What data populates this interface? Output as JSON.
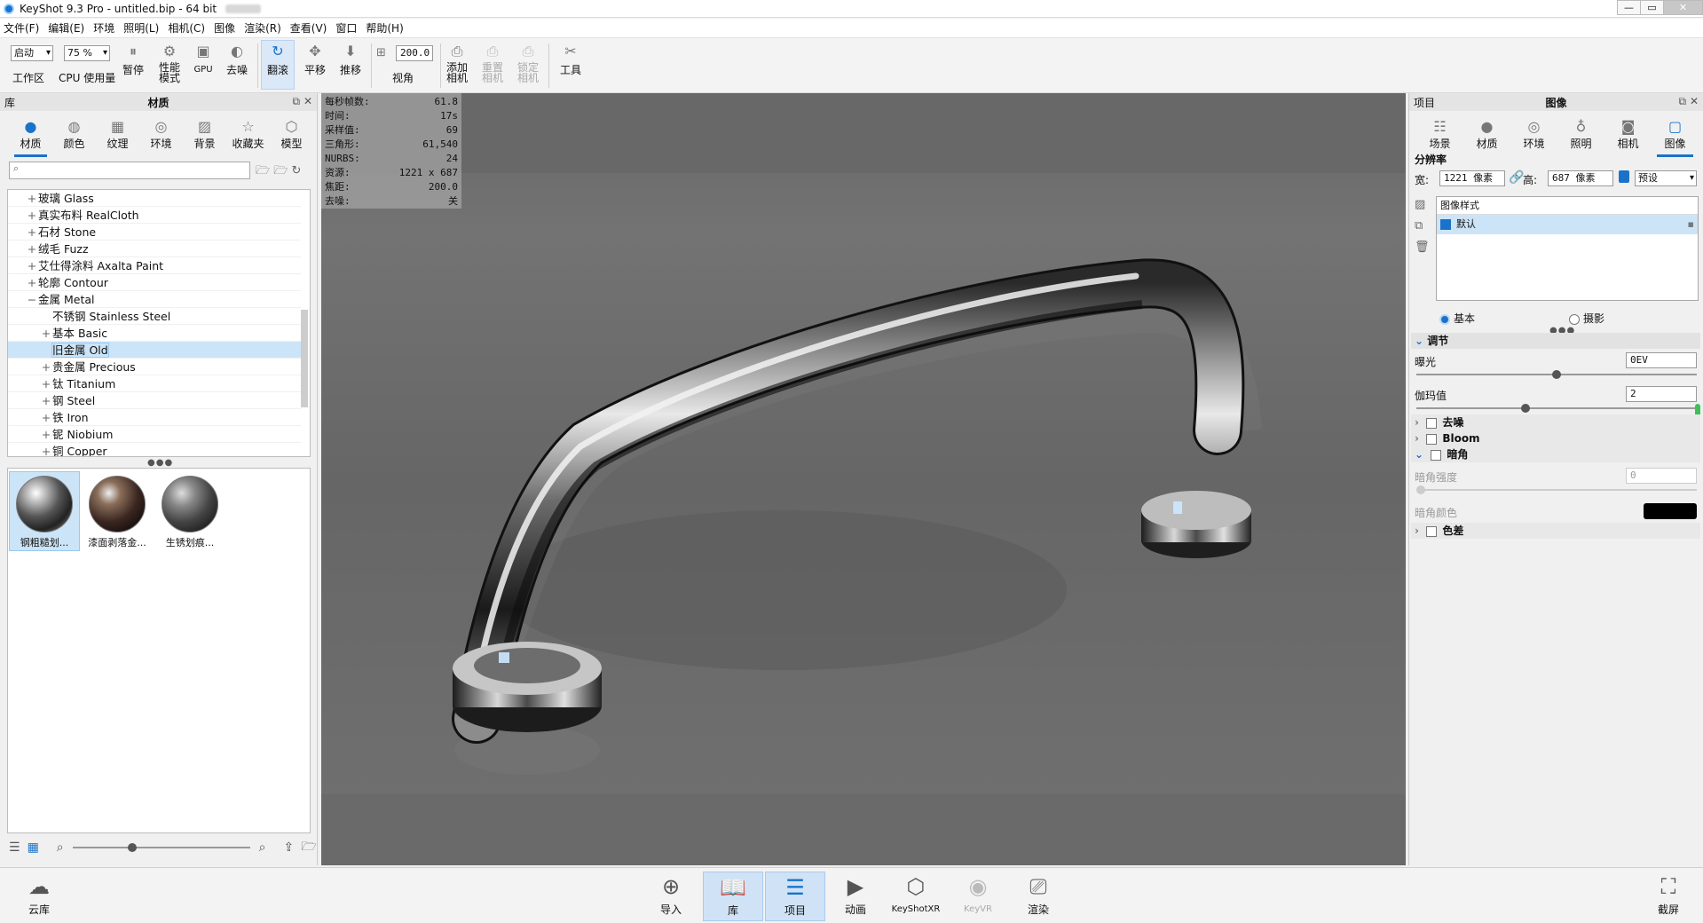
{
  "window": {
    "title": "KeyShot 9.3 Pro  - untitled.bip  - 64 bit",
    "btn_min": "—",
    "btn_max": "▭",
    "btn_close": "✕"
  },
  "menu": [
    "文件(F)",
    "编辑(E)",
    "环境",
    "照明(L)",
    "相机(C)",
    "图像",
    "渲染(R)",
    "查看(V)",
    "窗口",
    "帮助(H)"
  ],
  "toolbar": {
    "workspace_value": "启动",
    "workspace_label": "工作区",
    "cpu_value": "75 %",
    "cpu_label": "CPU 使用量",
    "pause_label": "暂停",
    "perf_label": "性能\n模式",
    "gpu_label": "GPU",
    "denoise_label": "去噪",
    "tumble_label": "翻滚",
    "pan_label": "平移",
    "dolly_label": "推移",
    "fov_value": "200.0",
    "fov_label": "视角",
    "add_camera_label": "添加\n相机",
    "reset_camera_label": "重置\n相机",
    "lock_camera_label": "锁定\n相机",
    "tools_label": "工具"
  },
  "library": {
    "panel_title": "库",
    "header": "材质",
    "tabs": [
      "材质",
      "颜色",
      "纹理",
      "环境",
      "背景",
      "收藏夹",
      "模型"
    ],
    "search_placeholder": "",
    "tree": [
      {
        "pm": "+",
        "label": "玻璃 Glass",
        "indent": 0
      },
      {
        "pm": "+",
        "label": "真实布料 RealCloth",
        "indent": 0
      },
      {
        "pm": "+",
        "label": "石材 Stone",
        "indent": 0
      },
      {
        "pm": "+",
        "label": "绒毛 Fuzz",
        "indent": 0
      },
      {
        "pm": "+",
        "label": "艾仕得涂料 Axalta Paint",
        "indent": 0
      },
      {
        "pm": "+",
        "label": "轮廓 Contour",
        "indent": 0
      },
      {
        "pm": "−",
        "label": "金属 Metal",
        "indent": 0
      },
      {
        "pm": "",
        "label": "不锈钢 Stainless Steel",
        "indent": 1
      },
      {
        "pm": "+",
        "label": "基本 Basic",
        "indent": 1
      },
      {
        "pm": "",
        "label": "旧金属 Old",
        "indent": 1,
        "selected": true
      },
      {
        "pm": "+",
        "label": "贵金属 Precious",
        "indent": 1
      },
      {
        "pm": "+",
        "label": "钛 Titanium",
        "indent": 1
      },
      {
        "pm": "+",
        "label": "钢 Steel",
        "indent": 1
      },
      {
        "pm": "+",
        "label": "铁 Iron",
        "indent": 1
      },
      {
        "pm": "+",
        "label": "铌 Niobium",
        "indent": 1
      },
      {
        "pm": "+",
        "label": "铜 Copper",
        "indent": 1
      }
    ],
    "thumbnails": [
      "钢粗糙划...",
      "漆面剥落金...",
      "生锈划痕..."
    ]
  },
  "stats": [
    {
      "k": "每秒帧数:",
      "v": "61.8"
    },
    {
      "k": "时间:",
      "v": "17s"
    },
    {
      "k": "采样值:",
      "v": "69"
    },
    {
      "k": "三角形:",
      "v": "61,540"
    },
    {
      "k": "NURBS:",
      "v": "24"
    },
    {
      "k": "资源:",
      "v": "1221 x 687"
    },
    {
      "k": "焦距:",
      "v": "200.0"
    },
    {
      "k": "去噪:",
      "v": "关"
    }
  ],
  "project": {
    "panel_title": "项目",
    "header": "图像",
    "tabs": [
      "场景",
      "材质",
      "环境",
      "照明",
      "相机",
      "图像"
    ],
    "resolution_label": "分辨率",
    "width_label": "宽:",
    "width_value": "1221 像素",
    "height_label": "高:",
    "height_value": "687 像素",
    "preset_value": "预设",
    "style_list_header": "图像样式",
    "style_item": "默认",
    "mode_basic": "基本",
    "mode_photo": "摄影",
    "adjust_header": "调节",
    "exposure_label": "曝光",
    "exposure_value": "0EV",
    "exposure_slider": 0.5,
    "gamma_label": "伽玛值",
    "gamma_value": "2",
    "gamma_slider": 0.39,
    "denoise_label": "去噪",
    "bloom_label": "Bloom",
    "vignette_label": "暗角",
    "vignette_strength_label": "暗角强度",
    "vignette_strength_value": "0",
    "vignette_color_label": "暗角颜色",
    "vignette_color": "#000000",
    "chroma_label": "色差"
  },
  "bottombar": {
    "cloud_label": "云库",
    "import_label": "导入",
    "library_label": "库",
    "project_label": "项目",
    "animation_label": "动画",
    "keyshotxr_label": "KeyShotXR",
    "keyvr_label": "KeyVR",
    "render_label": "渲染",
    "screenshot_label": "截屏"
  },
  "accent": "#1a73c8"
}
